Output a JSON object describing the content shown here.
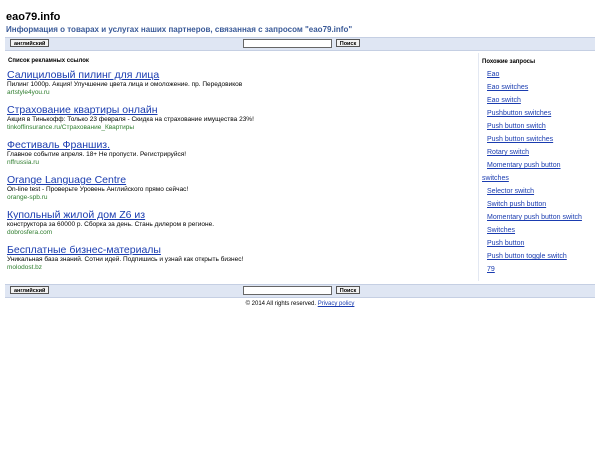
{
  "site": {
    "title": "eao79.info",
    "subtitle": "Информация о товарах и услугах наших партнеров, связанная с запросом \"eao79.info\""
  },
  "bar": {
    "language_label": "английский",
    "search_value": "",
    "search_button": "Поиск"
  },
  "ads": {
    "header": "Список рекламных ссылок",
    "items": [
      {
        "title": "Салициловый пилинг для лица",
        "desc": "Пилинг 1000р. Акция! Улучшение цвета лица и омоложение. пр. Передовиков",
        "url": "artstyle4you.ru"
      },
      {
        "title": "Страхование квартиры онлайн",
        "desc": "Акция в Тинькофф: Только 23 февраля - Скидка на страхование имущества 23%!",
        "url": "tinkoffinsurance.ru/Страхование_Квартиры"
      },
      {
        "title": "Фестиваль Франшиз.",
        "desc": "Главное событие апреля. 18+ Не пропусти. Регистрируйся!",
        "url": "nffrussia.ru"
      },
      {
        "title": "Orange Language Centre",
        "desc": "On-line test - Проверьте Уровень Английского прямо сейчас!",
        "url": "orange-spb.ru"
      },
      {
        "title": "Купольный жилой дом Z6 из",
        "desc": "конструктора за 60000 р. Сборка за день. Стань дилером в регионе.",
        "url": "dobrosfera.com"
      },
      {
        "title": "Бесплатные бизнес-материалы",
        "desc": "Уникальная база знаний. Сотни идей. Подпишись и узнай как открыть бизнес!",
        "url": "molodost.bz"
      }
    ]
  },
  "related": {
    "header": "Похожие запросы",
    "items": [
      "Eao",
      "Eao switches",
      "Eao switch",
      "Pushbutton switches",
      "Push button switch",
      "Push button switches",
      "Rotary switch",
      "Momentary push button",
      "switches",
      "Selector switch",
      "Switch push button",
      "Momentary push button switch",
      "Switches",
      "Push button",
      "Push button toggle switch",
      "79"
    ]
  },
  "footer": {
    "copyright": "© 2014 All rights reserved.",
    "privacy": "Privacy policy"
  },
  "colors": {
    "link": "#1a3cb0",
    "url": "#2e7d2e",
    "subtitle": "#3a5a98",
    "bar": "#dfe6f3"
  }
}
